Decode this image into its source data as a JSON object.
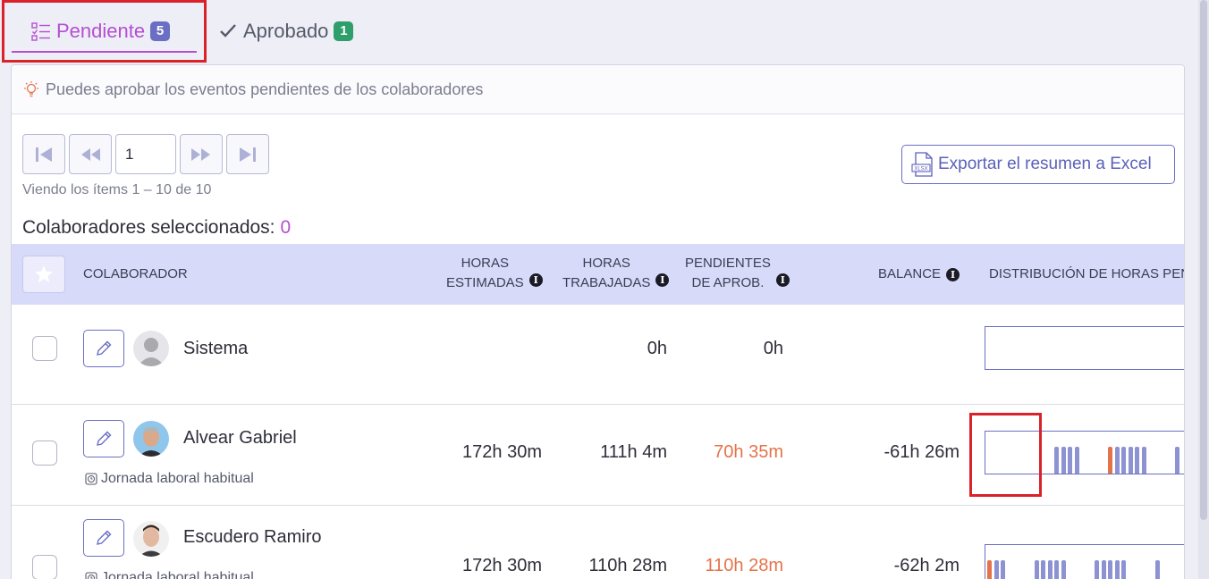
{
  "tabs": {
    "pending": {
      "label": "Pendiente",
      "count": "5"
    },
    "approved": {
      "label": "Aprobado",
      "count": "1"
    }
  },
  "hint": "Puedes aprobar los eventos pendientes de los colaboradores",
  "pager": {
    "page": "1",
    "viewing": "Viendo los ítems 1 – 10  de  10"
  },
  "export_label": "Exportar el resumen a Excel",
  "selected": {
    "label": "Colaboradores seleccionados:",
    "count": "0"
  },
  "columns": {
    "collaborator": "COLABORADOR",
    "estimated_1": "HORAS",
    "estimated_2": "ESTIMADAS",
    "worked_1": "HORAS",
    "worked_2": "TRABAJADAS",
    "pending_1": "PENDIENTES",
    "pending_2": "DE APROB.",
    "balance": "BALANCE",
    "distribution": "DISTRIBUCIÓN DE HORAS PEND"
  },
  "rows": [
    {
      "name": "Sistema",
      "estimated": "",
      "worked": "0h",
      "pending": "0h",
      "balance": "",
      "schedule": "",
      "bars": []
    },
    {
      "name": "Alvear Gabriel",
      "estimated": "172h 30m",
      "worked": "111h 4m",
      "pending": "70h 35m",
      "balance": "-61h 26m",
      "schedule": "Jornada laboral habitual",
      "bars": [
        0,
        0,
        0,
        0,
        0,
        0,
        0,
        0,
        0,
        0,
        0.9,
        0.9,
        0.9,
        0.9,
        0,
        0,
        0,
        0,
        0.9,
        0.9,
        0.9,
        0.9,
        0.9,
        0.9,
        0,
        0,
        0,
        0,
        0.9,
        0,
        0,
        0,
        0
      ]
    },
    {
      "name": "Escudero Ramiro",
      "estimated": "172h 30m",
      "worked": "110h 28m",
      "pending": "110h 28m",
      "balance": "-62h 2m",
      "schedule": "Jornada laboral habitual",
      "bars": [
        0.9,
        0.9,
        0.9,
        0,
        0,
        0,
        0,
        0.9,
        0.9,
        0.9,
        0.9,
        0.9,
        0,
        0,
        0,
        0,
        0.9,
        0.9,
        0.9,
        0.9,
        0.9,
        0,
        0,
        0,
        0,
        0.9,
        0,
        0,
        0
      ]
    }
  ],
  "colors": {
    "accent": "#b44fd2",
    "primary": "#6a6fc4",
    "orange": "#e5734a",
    "bar": "#8d92d2",
    "approved_badge": "#2e9e6b"
  }
}
